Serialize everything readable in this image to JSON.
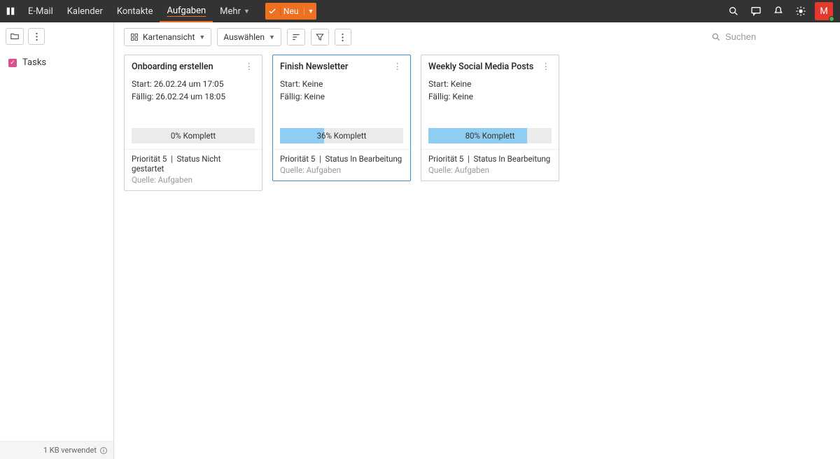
{
  "topbar": {
    "nav": [
      "E-Mail",
      "Kalender",
      "Kontakte",
      "Aufgaben",
      "Mehr"
    ],
    "active_index": 3,
    "new_label": "Neu",
    "avatar_initial": "M"
  },
  "sidebar": {
    "tasks_label": "Tasks",
    "footer": "1 KB verwendet"
  },
  "toolbar": {
    "view_label": "Kartenansicht",
    "select_label": "Auswählen",
    "search_placeholder": "Suchen"
  },
  "cards": [
    {
      "title": "Onboarding erstellen",
      "start_label": "Start: 26.02.24 um 17:05",
      "due_label": "Fällig: 26.02.24 um 18:05",
      "progress_pct": 0,
      "progress_text": "0% Komplett",
      "priority_label": "Priorität 5",
      "status_label": "Status Nicht gestartet",
      "source_label": "Quelle: Aufgaben",
      "selected": false
    },
    {
      "title": "Finish Newsletter",
      "start_label": "Start: Keine",
      "due_label": "Fällig: Keine",
      "progress_pct": 36,
      "progress_text": "36% Komplett",
      "priority_label": "Priorität 5",
      "status_label": "Status In Bearbeitung",
      "source_label": "Quelle: Aufgaben",
      "selected": true
    },
    {
      "title": "Weekly Social Media Posts",
      "start_label": "Start: Keine",
      "due_label": "Fällig: Keine",
      "progress_pct": 80,
      "progress_text": "80% Komplett",
      "priority_label": "Priorität 5",
      "status_label": "Status In Bearbeitung",
      "source_label": "Quelle: Aufgaben",
      "selected": false
    }
  ]
}
